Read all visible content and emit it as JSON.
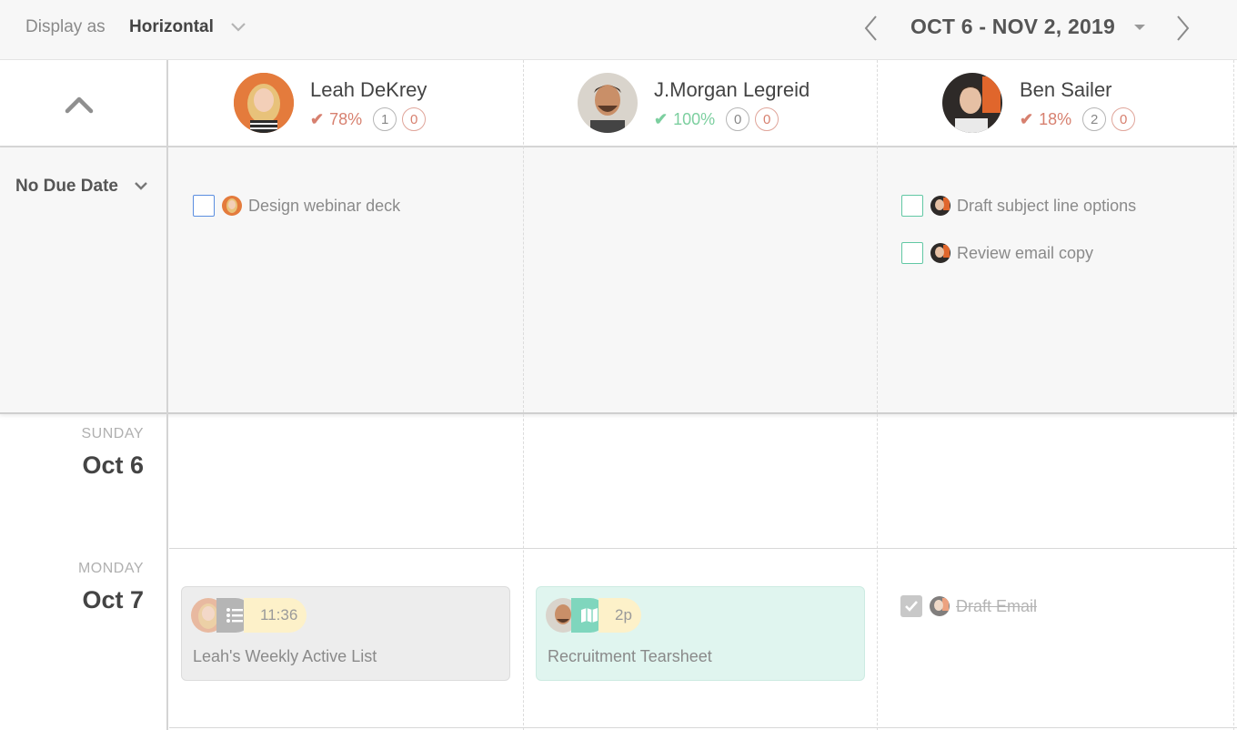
{
  "toolbar": {
    "display_label": "Display as",
    "display_value": "Horizontal",
    "range": "OCT 6 - NOV 2, 2019"
  },
  "people": [
    {
      "name": "Leah DeKrey",
      "pct": "78%",
      "count_a": "1",
      "count_b": "0",
      "status_color": "#d7806f"
    },
    {
      "name": "J.Morgan Legreid",
      "pct": "100%",
      "count_a": "0",
      "count_b": "0",
      "status_color": "#7ccf9f"
    },
    {
      "name": "Ben Sailer",
      "pct": "18%",
      "count_a": "2",
      "count_b": "0",
      "status_color": "#d7806f"
    }
  ],
  "no_due": {
    "label": "No Due Date",
    "tasks": {
      "leah": [
        "Design webinar deck"
      ],
      "ben": [
        "Draft subject line options",
        "Review email copy"
      ]
    }
  },
  "days": [
    {
      "weekday": "SUNDAY",
      "date": "Oct 6"
    },
    {
      "weekday": "MONDAY",
      "date": "Oct 7"
    }
  ],
  "cards": {
    "leah": {
      "time": "11:36",
      "title": "Leah's Weekly Active List",
      "icon": "list-icon"
    },
    "morgan": {
      "time": "2p",
      "title": "Recruitment Tearsheet",
      "icon": "map-icon"
    },
    "ben_done": {
      "title": "Draft Email"
    }
  },
  "colors": {
    "accent_blue": "#5b8ee0",
    "accent_green": "#61c8a4",
    "pill_yellow": "#fdf1c9",
    "teal_card": "#e0f5ef"
  }
}
